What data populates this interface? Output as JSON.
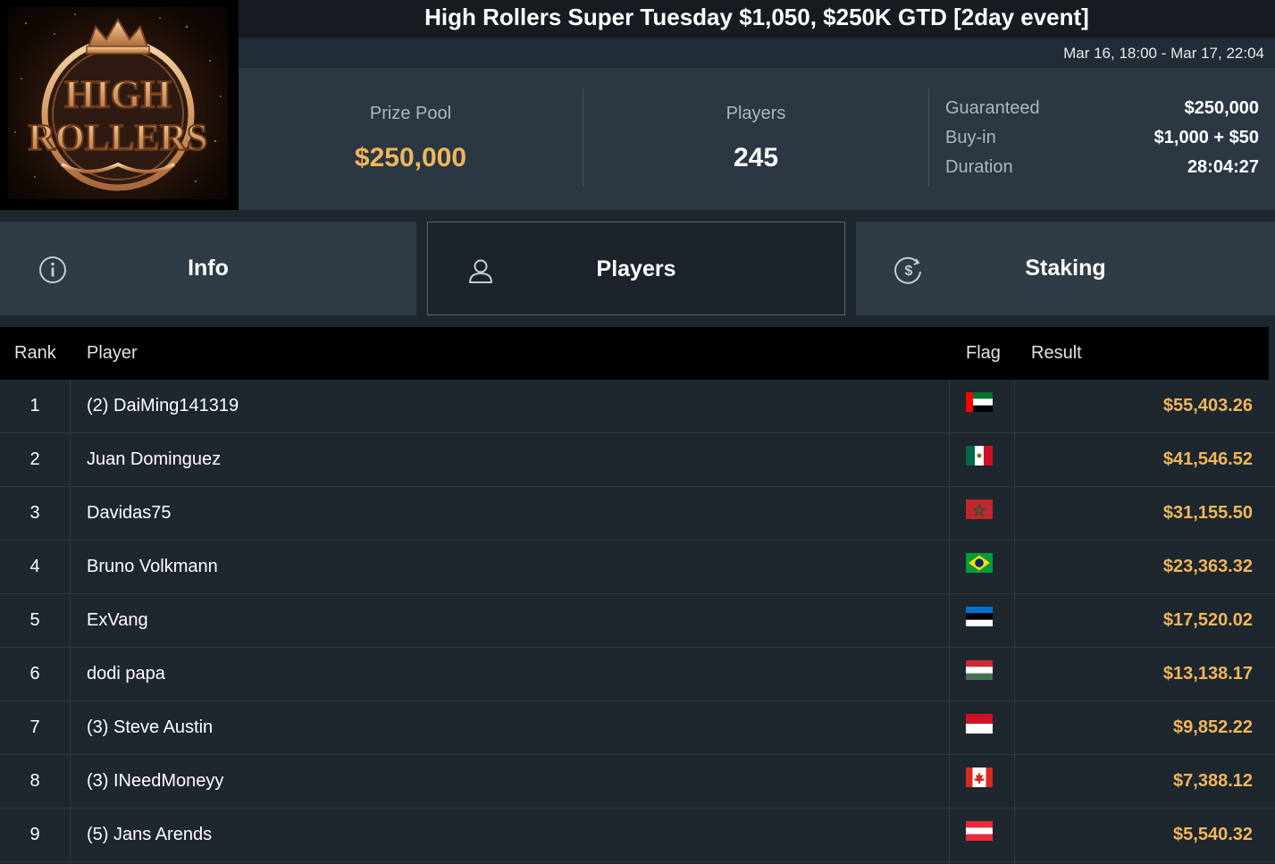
{
  "logo": {
    "line1": "HIGH",
    "line2": "ROLLERS"
  },
  "header": {
    "title": "High Rollers Super Tuesday $1,050, $250K GTD [2day event]",
    "dates": "Mar 16, 18:00 - Mar 17, 22:04"
  },
  "stats": {
    "prize_pool_label": "Prize Pool",
    "prize_pool_value": "$250,000",
    "players_label": "Players",
    "players_value": "245",
    "guaranteed_label": "Guaranteed",
    "guaranteed_value": "$250,000",
    "buyin_label": "Buy-in",
    "buyin_value": "$1,000 + $50",
    "duration_label": "Duration",
    "duration_value": "28:04:27"
  },
  "tabs": [
    {
      "label": "Info",
      "icon": "info-icon",
      "active": false
    },
    {
      "label": "Players",
      "icon": "user-icon",
      "active": true
    },
    {
      "label": "Staking",
      "icon": "dollar-coin-icon",
      "active": false
    }
  ],
  "table": {
    "columns": {
      "rank": "Rank",
      "player": "Player",
      "flag": "Flag",
      "result": "Result"
    },
    "rows": [
      {
        "rank": "1",
        "player": "(2) DaiMing141319",
        "flag": "uae-flag",
        "result": "$55,403.26"
      },
      {
        "rank": "2",
        "player": "Juan Dominguez",
        "flag": "mexico-flag",
        "result": "$41,546.52"
      },
      {
        "rank": "3",
        "player": "Davidas75",
        "flag": "morocco-flag",
        "result": "$31,155.50"
      },
      {
        "rank": "4",
        "player": "Bruno Volkmann",
        "flag": "brazil-flag",
        "result": "$23,363.32"
      },
      {
        "rank": "5",
        "player": "ExVang",
        "flag": "estonia-flag",
        "result": "$17,520.02"
      },
      {
        "rank": "6",
        "player": "dodi papa",
        "flag": "hungary-flag",
        "result": "$13,138.17"
      },
      {
        "rank": "7",
        "player": "(3) Steve Austin",
        "flag": "indonesia-flag",
        "result": "$9,852.22"
      },
      {
        "rank": "8",
        "player": "(3) INeedMoneyy",
        "flag": "canada-flag",
        "result": "$7,388.12"
      },
      {
        "rank": "9",
        "player": "(5) Jans Arends",
        "flag": "austria-flag",
        "result": "$5,540.32"
      }
    ]
  },
  "colors": {
    "accent_gold": "#f0b75a",
    "background": "#1e262e",
    "panel": "#2b3743"
  }
}
